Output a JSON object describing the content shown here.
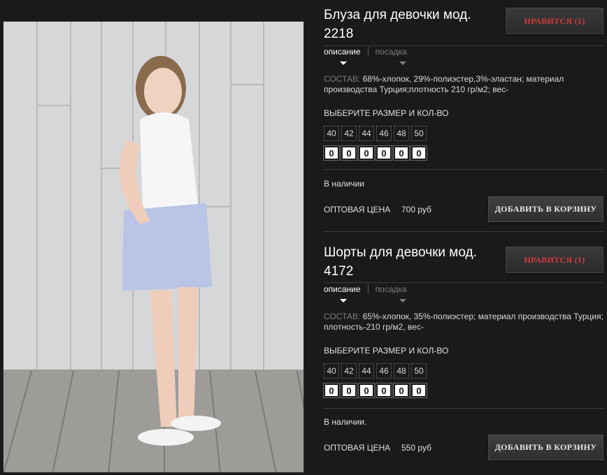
{
  "products": [
    {
      "title": "Блуза для девочки мод. 2218",
      "like_label": "НРАВИТСЯ (1)",
      "tabs": [
        "описание",
        "посадка"
      ],
      "composition_label": "СОСТАВ:",
      "composition_text": "68%-хлопок, 29%-полиэстер,3%-эластан; материал производства Турция;плотность 210 гр/м2; вес-",
      "size_header": "ВЫБЕРИТЕ РАЗМЕР И КОЛ-ВО",
      "sizes": [
        "40",
        "42",
        "44",
        "46",
        "48",
        "50"
      ],
      "quantities": [
        "0",
        "0",
        "0",
        "0",
        "0",
        "0"
      ],
      "stock": "В наличии",
      "price_label": "ОПТОВАЯ ЦЕНА",
      "price": "700 руб",
      "cart_label": "ДОБАВИТЬ В КОРЗИНУ"
    },
    {
      "title": "Шорты для девочки мод. 4172",
      "like_label": "НРАВИТСЯ (1)",
      "tabs": [
        "описание",
        "посадка"
      ],
      "composition_label": "СОСТАВ:",
      "composition_text": "65%-хлопок, 35%-полиэстер; материал производства Турция; плотность-210 гр/м2, вес-",
      "size_header": "ВЫБЕРИТЕ РАЗМЕР И КОЛ-ВО",
      "sizes": [
        "40",
        "42",
        "44",
        "46",
        "48",
        "50"
      ],
      "quantities": [
        "0",
        "0",
        "0",
        "0",
        "0",
        "0"
      ],
      "stock": "В наличии.",
      "price_label": "ОПТОВАЯ ЦЕНА",
      "price": "550 руб",
      "cart_label": "ДОБАВИТЬ В КОРЗИНУ"
    }
  ],
  "colors": {
    "background": "#1a191b",
    "like_text": "#d33a3a",
    "muted": "#7d7d80"
  }
}
